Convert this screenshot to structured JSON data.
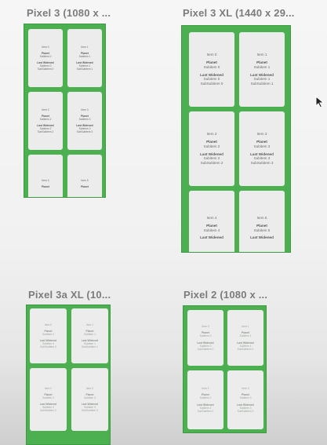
{
  "devices": {
    "pixel3": {
      "title": "Pixel 3 (1080 x ...",
      "cards": [
        {
          "item": "Item 0",
          "planet": "Planet",
          "sub": "Subitem 0",
          "last": "Last Widened",
          "s1": "Subitem 0",
          "s2": "SubSubitem 0"
        },
        {
          "item": "Item 1",
          "planet": "Planet",
          "sub": "Subitem 1",
          "last": "Last Widened",
          "s1": "Subitem 1",
          "s2": "SubSubitem 1"
        },
        {
          "item": "Item 2",
          "planet": "Planet",
          "sub": "Subitem 2",
          "last": "Last Widened",
          "s1": "Subitem 2",
          "s2": "SubSubitem 2"
        },
        {
          "item": "Item 3",
          "planet": "Planet",
          "sub": "Subitem 3",
          "last": "Last Widened",
          "s1": "Subitem 3",
          "s2": "SubSubitem 3"
        },
        {
          "item": "Item 4",
          "planet": "Planet",
          "sub": "",
          "last": "",
          "s1": "",
          "s2": ""
        },
        {
          "item": "Item 5",
          "planet": "Planet",
          "sub": "",
          "last": "",
          "s1": "",
          "s2": ""
        }
      ]
    },
    "pixel3xl": {
      "title": "Pixel 3 XL (1440 x 29...",
      "cards": [
        {
          "item": "Item 0",
          "planet": "Planet",
          "sub": "Subitem 0",
          "last": "Last Widened",
          "s1": "Subitem 0",
          "s2": "SubSubitem 0"
        },
        {
          "item": "Item 1",
          "planet": "Planet",
          "sub": "Subitem 1",
          "last": "Last Widened",
          "s1": "Subitem 1",
          "s2": "SubSubitem 1"
        },
        {
          "item": "Item 2",
          "planet": "Planet",
          "sub": "Subitem 2",
          "last": "Last Widened",
          "s1": "Subitem 2",
          "s2": "SubSubitem 2"
        },
        {
          "item": "Item 3",
          "planet": "Planet",
          "sub": "Subitem 3",
          "last": "Last Widened",
          "s1": "Subitem 3",
          "s2": "SubSubitem 3"
        },
        {
          "item": "Item 4",
          "planet": "Planet",
          "sub": "Subitem 4",
          "last": "Last Widened",
          "s1": "",
          "s2": ""
        },
        {
          "item": "Item 5",
          "planet": "Planet",
          "sub": "Subitem 5",
          "last": "Last Widened",
          "s1": "",
          "s2": ""
        }
      ]
    },
    "pixel3axl": {
      "title": "Pixel 3a XL (10...",
      "cards": [
        {
          "item": "Item 0",
          "planet": "Planet",
          "sub": "Subitem 0",
          "last": "Last Widened",
          "s1": "Subitem 0",
          "s2": "SubSubitem 0"
        },
        {
          "item": "Item 1",
          "planet": "Planet",
          "sub": "Subitem 1",
          "last": "Last Widened",
          "s1": "Subitem 1",
          "s2": "SubSubitem 1"
        },
        {
          "item": "Item 2",
          "planet": "Planet",
          "sub": "Subitem 2",
          "last": "Last Widened",
          "s1": "Subitem 2",
          "s2": "SubSubitem 2"
        },
        {
          "item": "Item 3",
          "planet": "Planet",
          "sub": "Subitem 3",
          "last": "Last Widened",
          "s1": "Subitem 3",
          "s2": "SubSubitem 3"
        }
      ]
    },
    "pixel2": {
      "title": "Pixel 2 (1080 x ...",
      "cards": [
        {
          "item": "Item 0",
          "planet": "Planet",
          "sub": "Subitem 0",
          "last": "Last Widened",
          "s1": "Subitem 0",
          "s2": "SubSubitem 0"
        },
        {
          "item": "Item 1",
          "planet": "Planet",
          "sub": "Subitem 1",
          "last": "Last Widened",
          "s1": "Subitem 1",
          "s2": "SubSubitem 1"
        },
        {
          "item": "Item 2",
          "planet": "Planet",
          "sub": "Subitem 2",
          "last": "Last Widened",
          "s1": "Subitem 2",
          "s2": "SubSubitem 2"
        },
        {
          "item": "Item 3",
          "planet": "Planet",
          "sub": "Subitem 3",
          "last": "Last Widened",
          "s1": "Subitem 3",
          "s2": "SubSubitem 3"
        }
      ]
    }
  },
  "colors": {
    "frame": "#4caf50",
    "card": "#ececec",
    "title": "#7c7c7c"
  },
  "icons": {
    "cursor": "mouse-pointer-icon"
  }
}
